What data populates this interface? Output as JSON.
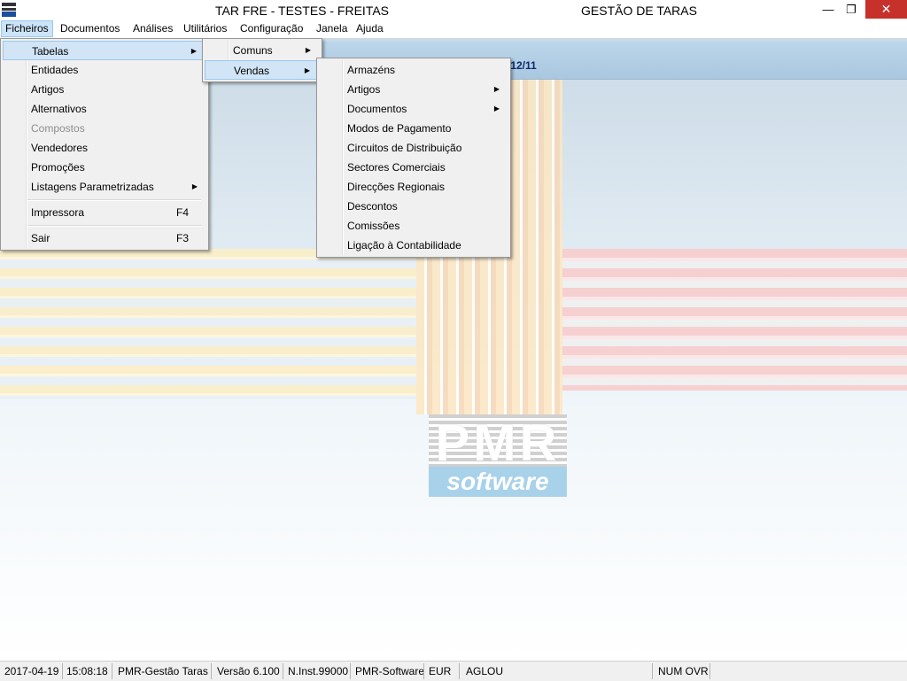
{
  "window": {
    "title_left": "TAR FRE - TESTES - FREITAS",
    "title_right": "GESTÃO DE TARAS",
    "minimize_glyph": "—",
    "maximize_glyph": "❐",
    "close_glyph": "✕"
  },
  "menubar": [
    "Ficheiros",
    "Documentos",
    "Análises",
    "Utilitários",
    "Configuração",
    "Janela",
    "Ajuda"
  ],
  "header": {
    "date_fragment": "/12/11"
  },
  "logo": {
    "top_text": "PMR",
    "bottom_text": "software"
  },
  "ficheiros_menu": [
    {
      "label": "Tabelas",
      "submenu": true
    },
    {
      "label": "Entidades"
    },
    {
      "label": "Artigos"
    },
    {
      "label": "Alternativos"
    },
    {
      "label": "Compostos",
      "disabled": true
    },
    {
      "label": "Vendedores"
    },
    {
      "label": "Promoções"
    },
    {
      "label": "Listagens Parametrizadas",
      "submenu": true
    },
    {
      "label": "Impressora",
      "shortcut": "F4"
    },
    {
      "label": "Sair",
      "shortcut": "F3"
    }
  ],
  "tabelas_menu": [
    {
      "label": "Comuns"
    },
    {
      "label": "Vendas"
    }
  ],
  "vendas_menu": [
    {
      "label": "Armazéns"
    },
    {
      "label": "Artigos",
      "submenu": true
    },
    {
      "label": "Documentos",
      "submenu": true
    },
    {
      "label": "Modos de Pagamento"
    },
    {
      "label": "Circuitos de Distribuição"
    },
    {
      "label": "Sectores Comerciais"
    },
    {
      "label": "Direcções Regionais"
    },
    {
      "label": "Descontos"
    },
    {
      "label": "Comissões"
    },
    {
      "label": "Ligação à Contabilidade"
    }
  ],
  "statusbar": {
    "date": "2017-04-19",
    "time": "15:08:18",
    "app": "PMR-Gestão Taras",
    "version": "Versão  6.100",
    "inst": "N.Inst.99000",
    "vendor": "PMR-Software",
    "currency": "EUR",
    "user": "AGLOU",
    "keys": "NUM OVR"
  }
}
